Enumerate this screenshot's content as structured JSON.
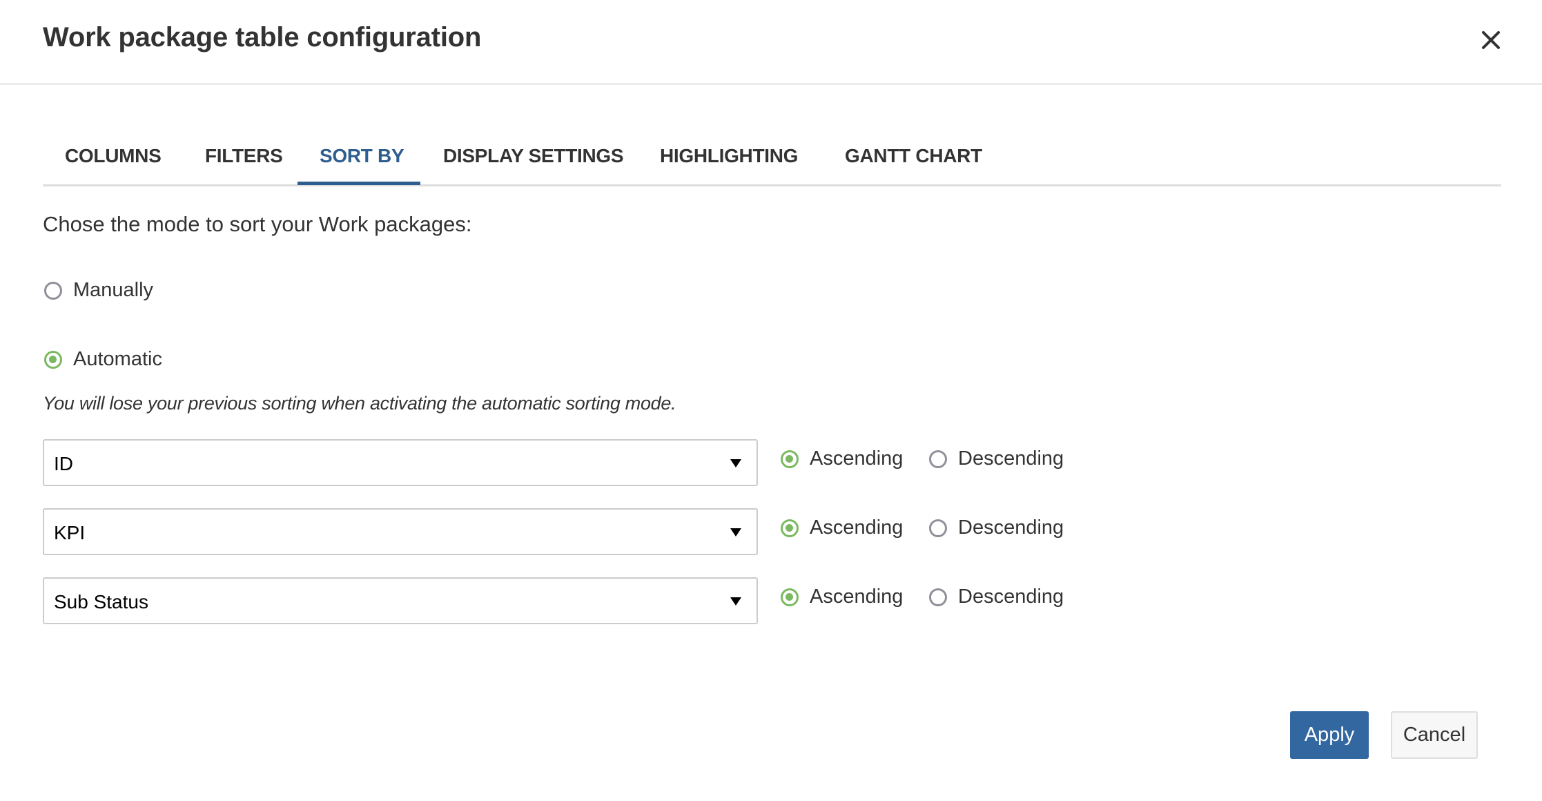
{
  "dialog": {
    "title": "Work package table configuration",
    "close_icon": "close-icon"
  },
  "tabs": [
    {
      "label": "COLUMNS",
      "active": false
    },
    {
      "label": "FILTERS",
      "active": false
    },
    {
      "label": "SORT BY",
      "active": true
    },
    {
      "label": "DISPLAY SETTINGS",
      "active": false
    },
    {
      "label": "HIGHLIGHTING",
      "active": false
    },
    {
      "label": "GANTT CHART",
      "active": false
    }
  ],
  "sort": {
    "prompt": "Chose the mode to sort your Work packages:",
    "modes": [
      {
        "label": "Manually",
        "checked": false
      },
      {
        "label": "Automatic",
        "checked": true
      }
    ],
    "note": "You will lose your previous sorting when activating the automatic sorting mode.",
    "criteria": [
      {
        "field": "ID",
        "ascending_label": "Ascending",
        "descending_label": "Descending",
        "direction": "ascending"
      },
      {
        "field": "KPI",
        "ascending_label": "Ascending",
        "descending_label": "Descending",
        "direction": "ascending"
      },
      {
        "field": "Sub Status",
        "ascending_label": "Ascending",
        "descending_label": "Descending",
        "direction": "ascending"
      }
    ]
  },
  "footer": {
    "apply_label": "Apply",
    "cancel_label": "Cancel"
  },
  "colors": {
    "accent_blue": "#3267a0",
    "active_tab": "#2e5d8f",
    "radio_checked": "#7ab962",
    "radio_unchecked": "#8f909a"
  }
}
